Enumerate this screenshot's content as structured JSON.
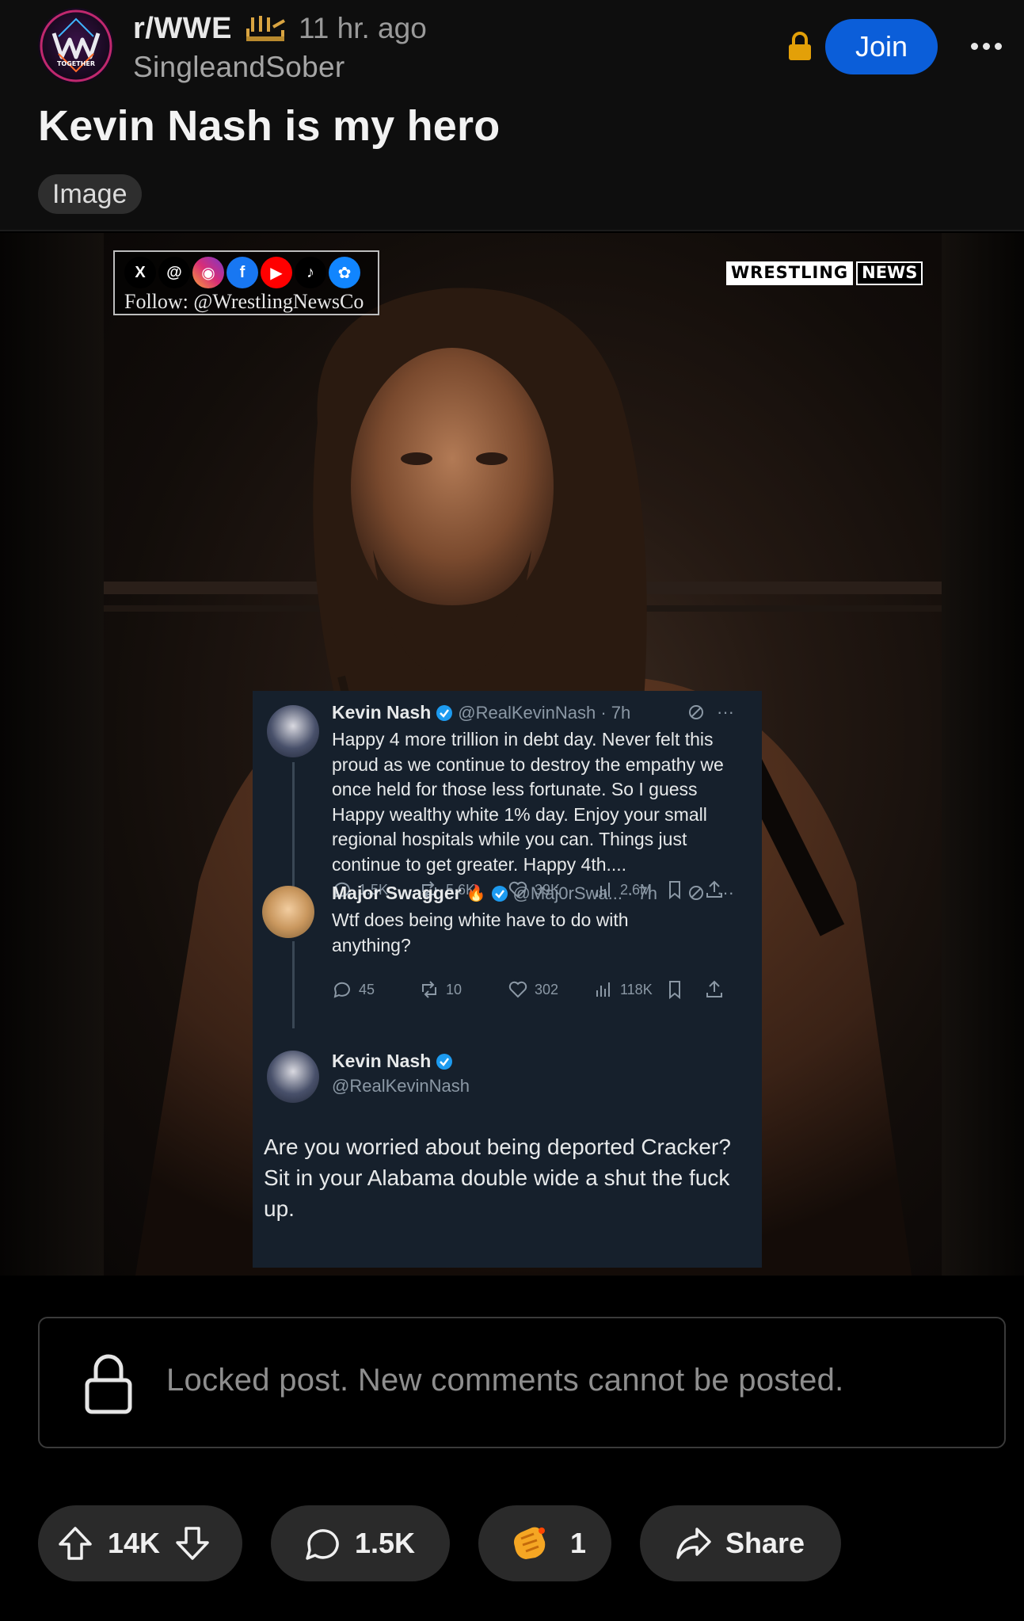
{
  "post": {
    "subreddit": "r/WWE",
    "time_ago": "11 hr. ago",
    "author": "SingleandSober",
    "join_label": "Join",
    "title": "Kevin Nash is my hero",
    "flair": "Image",
    "avatar_text": "TOGETHER"
  },
  "media": {
    "follow_text": "Follow: @WrestlingNewsCo",
    "watermark_part1": "WRESTLING",
    "watermark_part2": "NEWS",
    "tweets": [
      {
        "name": "Kevin Nash",
        "handle": "@RealKevinNash · 7h",
        "text": "Happy 4 more trillion in debt day. Never felt this proud as we continue to destroy the empathy we once held for those less fortunate. So I guess Happy wealthy white 1% day. Enjoy your small regional hospitals while you can. Things just continue to get greater.  Happy 4th....",
        "replies": "1.5K",
        "retweets": "5.6K",
        "likes": "39K",
        "views": "2.6M"
      },
      {
        "name": "Major Swagger",
        "handle": "@Maj0rSwa... · 7h",
        "text": "Wtf does being white have to do with anything?",
        "replies": "45",
        "retweets": "10",
        "likes": "302",
        "views": "118K"
      },
      {
        "name": "Kevin Nash",
        "handle": "@RealKevinNash",
        "text": "Are you worried about being deported Cracker? Sit in your Alabama double wide a shut the fuck up."
      }
    ]
  },
  "locked_message": "Locked post. New comments cannot be posted.",
  "actions": {
    "votes": "14K",
    "comments": "1.5K",
    "awards": "1",
    "share": "Share"
  }
}
